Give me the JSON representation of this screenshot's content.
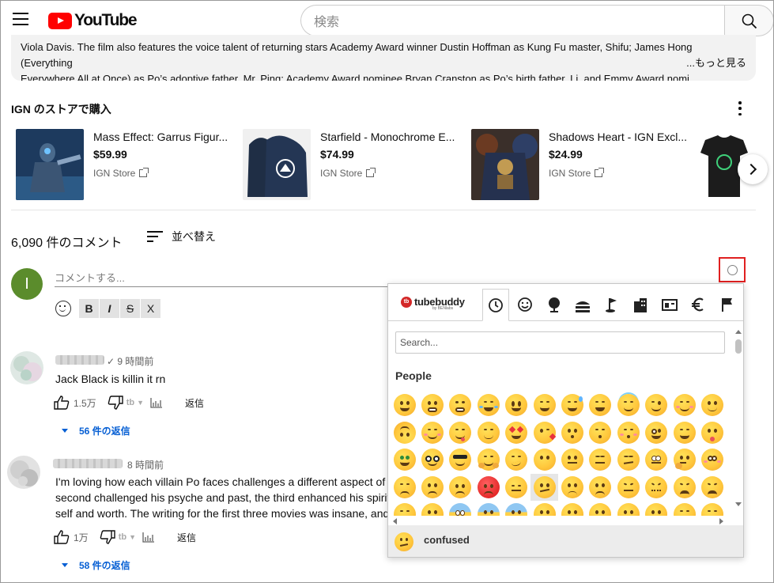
{
  "header": {
    "logo_text": "YouTube",
    "search_placeholder": "検索"
  },
  "description": {
    "line1": "Viola Davis. The film also features the voice talent of returning stars Academy Award winner Dustin Hoffman as Kung Fu master, Shifu; James Hong (Everything",
    "line2": "Everywhere All at Once) as Po’s adoptive father, Mr. Ping; Academy Award nominee Bryan Cranston as Po’s birth father, Li, and Emmy Award nomi",
    "more": "...もっと見る"
  },
  "store": {
    "title": "IGN のストアで購入",
    "products": [
      {
        "name": "Mass Effect: Garrus Figur...",
        "price": "$59.99",
        "store": "IGN Store"
      },
      {
        "name": "Starfield - Monochrome E...",
        "price": "$74.99",
        "store": "IGN Store"
      },
      {
        "name": "Shadows Heart - IGN Excl...",
        "price": "$24.99",
        "store": "IGN Store"
      }
    ]
  },
  "comments_header": {
    "count": "6,090 件のコメント",
    "sort_label": "並べ替え"
  },
  "add_comment": {
    "avatar_letter": "I",
    "placeholder": "コメントする...",
    "format_buttons": [
      "B",
      "I",
      "S",
      "X"
    ]
  },
  "comments": [
    {
      "time": "9 時間前",
      "lines": [
        "Jack Black is killin it rn"
      ],
      "likes": "1.5万",
      "reply_label": "返信",
      "replies": "56 件の返信"
    },
    {
      "time": "8 時間前",
      "lines": [
        "I'm loving how each villain Po faces challenges a different aspect of",
        "second challenged his psyche and past, the third enhanced his spirit",
        "self and worth. The writing for the first three movies was insane, and"
      ],
      "likes": "1万",
      "reply_label": "返信",
      "replies": "58 件の返信"
    }
  ],
  "emoji_panel": {
    "brand": "tubebuddy",
    "brand_sub": "by BENlabs",
    "tabs": [
      "recent",
      "people",
      "nature",
      "food",
      "activity",
      "travel",
      "objects",
      "symbols",
      "flags"
    ],
    "search_placeholder": "Search...",
    "category": "People",
    "selected_name": "confused"
  },
  "colors": {
    "accent_red": "#ff0000",
    "link_blue": "#065fd4",
    "avatar_green": "#5b8c2c",
    "highlight_border": "#e02020"
  }
}
